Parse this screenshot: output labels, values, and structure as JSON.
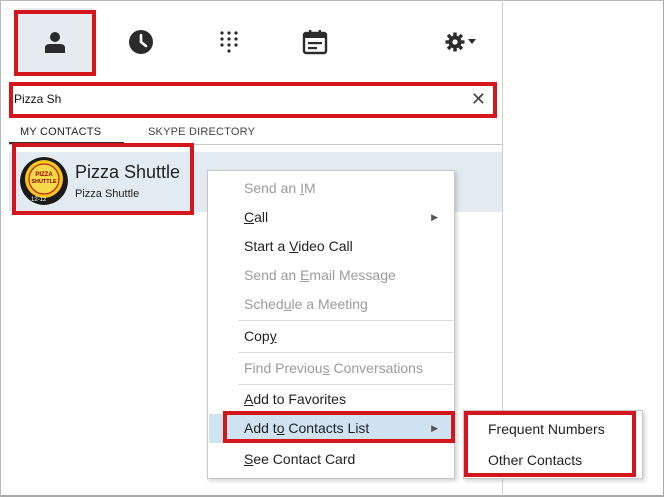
{
  "search": {
    "value": "Pizza Sh",
    "clear_icon": "close-icon"
  },
  "toolbar": {
    "icons": [
      "contacts-person-icon",
      "history-clock-icon",
      "dialpad-icon",
      "meetings-calendar-icon",
      "gear-icon"
    ]
  },
  "tabs": [
    {
      "label": "MY CONTACTS",
      "active": true
    },
    {
      "label": "SKYPE DIRECTORY",
      "active": false
    }
  ],
  "contact": {
    "name": "Pizza Shuttle",
    "subtitle": "Pizza Shuttle",
    "avatar_text": {
      "line1": "PIZZA",
      "line2": "SHUTTLE",
      "line3": "12-12"
    }
  },
  "context_menu": {
    "items": [
      {
        "pre": "Send an ",
        "key": "I",
        "post": "M",
        "disabled": true,
        "submenu": false
      },
      {
        "pre": "",
        "key": "C",
        "post": "all",
        "disabled": false,
        "submenu": true
      },
      {
        "pre": "Start a ",
        "key": "V",
        "post": "ideo Call",
        "disabled": false,
        "submenu": false
      },
      {
        "pre": "Send an ",
        "key": "E",
        "post": "mail Message",
        "disabled": true,
        "submenu": false
      },
      {
        "pre": "Sched",
        "key": "u",
        "post": "le a Meeting",
        "disabled": true,
        "submenu": false
      },
      {
        "pre": "Cop",
        "key": "y",
        "post": "",
        "disabled": false,
        "submenu": false
      },
      {
        "pre": "Find Previou",
        "key": "s",
        "post": " Conversations",
        "disabled": true,
        "submenu": false
      },
      {
        "pre": "",
        "key": "A",
        "post": "dd to Favorites",
        "disabled": false,
        "submenu": false
      },
      {
        "pre": "Add t",
        "key": "o",
        "post": " Contacts List",
        "disabled": false,
        "submenu": true,
        "highlighted": true
      },
      {
        "pre": "",
        "key": "S",
        "post": "ee Contact Card",
        "disabled": false,
        "submenu": false
      }
    ]
  },
  "submenu": {
    "items": [
      "Frequent Numbers",
      "Other Contacts"
    ]
  },
  "colors": {
    "highlight_red": "#d3161b",
    "menu_highlight": "#cfe3f3",
    "contact_row_bg": "#e3ebf2"
  }
}
